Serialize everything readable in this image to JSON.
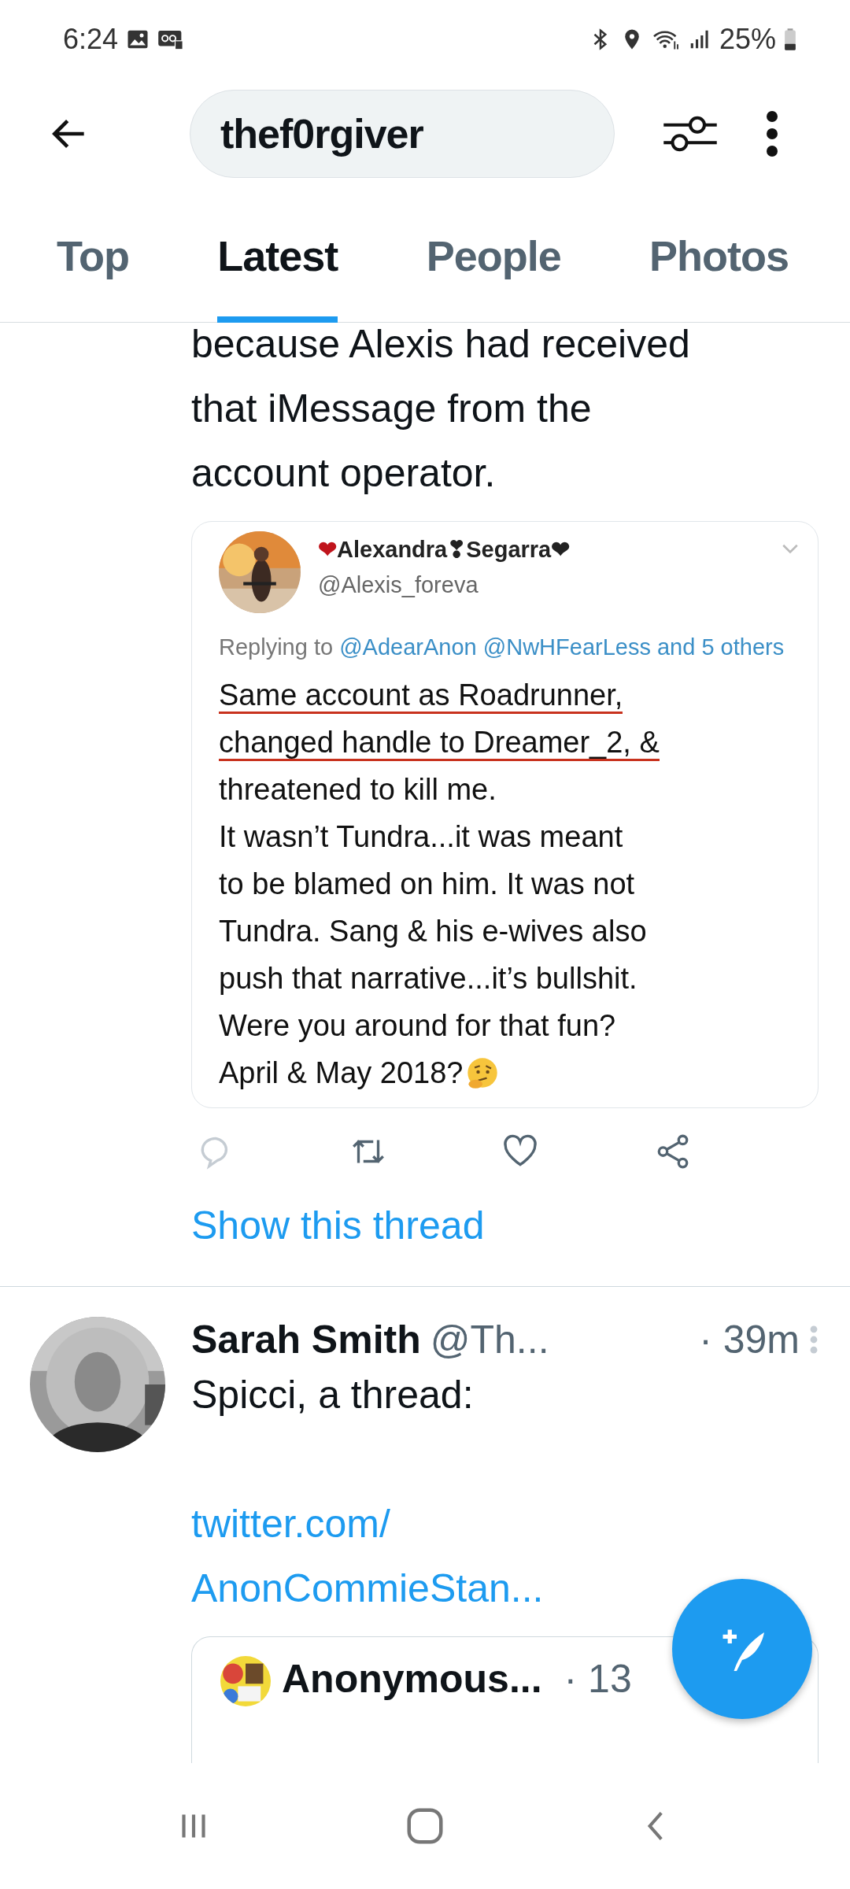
{
  "status_bar": {
    "time": "6:24",
    "battery": "25%"
  },
  "search": {
    "value": "thef0rgiver"
  },
  "tabs": [
    {
      "label": "Top",
      "selected": false
    },
    {
      "label": "Latest",
      "selected": true
    },
    {
      "label": "People",
      "selected": false
    },
    {
      "label": "Photos",
      "selected": false
    }
  ],
  "tweet": {
    "text_lines": [
      "because Alexis had received",
      "that iMessage from the",
      "account operator."
    ],
    "embedded_screenshot": {
      "name": "❤Alexandra❣Segarra❤",
      "handle": "@Alexis_foreva",
      "replying_label": "Replying to",
      "replying_targets": "@AdearAnon @NwHFearLess and 5 others",
      "body_lines": [
        {
          "text": "Same account as Roadrunner,",
          "underlined": true
        },
        {
          "text": "changed handle to Dreamer_2, &",
          "underlined": true
        },
        {
          "text": "threatened to kill me.",
          "underlined": false
        },
        {
          "text": "It wasn’t Tundra...it was meant",
          "underlined": false
        },
        {
          "text": "to be blamed on him. It was not",
          "underlined": false
        },
        {
          "text": "Tundra. Sang & his e-wives also",
          "underlined": false
        },
        {
          "text": "push that narrative...it’s bullshit.",
          "underlined": false
        },
        {
          "text": "Were you around for that fun?",
          "underlined": false
        }
      ],
      "closing": "April & May 2018?"
    },
    "show_thread": "Show this thread"
  },
  "tweet_2": {
    "name": "Sarah Smith",
    "handle": "@Th...",
    "time": "· 39m",
    "text": "Spicci, a thread:",
    "link_lines": [
      "twitter.com/",
      "AnonCommieStan..."
    ],
    "quote": {
      "name": "Anonymous...",
      "time": "· 13"
    }
  }
}
